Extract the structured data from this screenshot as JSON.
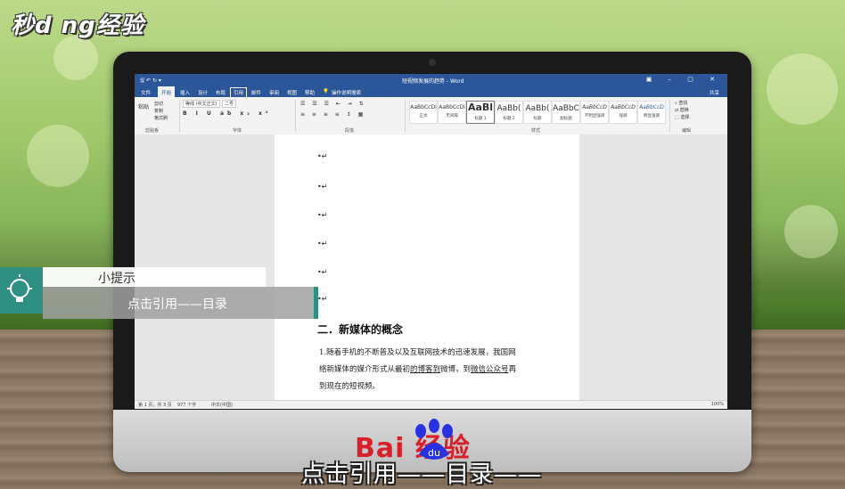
{
  "logo": "秒d ng经验",
  "brand": "Bai  经验",
  "brand_du": "du",
  "word": {
    "title": "短视频发展的趋势 - Word",
    "share": "共享",
    "tabs": [
      "文件",
      "开始",
      "插入",
      "设计",
      "布局",
      "引用",
      "邮件",
      "审阅",
      "视图",
      "帮助"
    ],
    "tell_me": "操作说明搜索",
    "ribbon": {
      "paste": "粘贴",
      "cut": "剪切",
      "copy": "复制",
      "format_painter": "格式刷",
      "font_name": "等线 (中文正文)",
      "font_size": "二号",
      "styles": [
        {
          "preview": "AaBbCcDi",
          "name": "正文"
        },
        {
          "preview": "AaBbCcDi",
          "name": "无间隔"
        },
        {
          "preview": "AaBl",
          "name": "标题 1"
        },
        {
          "preview": "AaBb(",
          "name": "标题 2"
        },
        {
          "preview": "AaBb(",
          "name": "标题"
        },
        {
          "preview": "AaBbC",
          "name": "副标题"
        },
        {
          "preview": "AaBbCcD",
          "name": "不明显强调"
        },
        {
          "preview": "AaBbCcD",
          "name": "强调"
        },
        {
          "preview": "AaBbCcD",
          "name": "明显强调"
        }
      ],
      "find": "查找",
      "replace": "替换",
      "select": "选择",
      "groups": {
        "clipboard": "剪贴板",
        "font": "字体",
        "paragraph": "段落",
        "styles": "样式",
        "editing": "编辑"
      }
    },
    "document": {
      "heading": "二．新媒体的概念",
      "para_line1": "1.随着手机的不断普及以及互联网技术的迅速发展，我国网",
      "para_line2_a": "络新媒体的媒介形式从最初",
      "para_line2_b": "的博客到",
      "para_line2_c": "微博，到",
      "para_line2_d": "微信公众号",
      "para_line2_e": "再",
      "para_line3": "到现在的短视频。"
    },
    "status": {
      "page": "第 1 页，共 3 页",
      "words": "977 个字",
      "lang": "中文(中国)",
      "zoom": "100%"
    }
  },
  "tip": {
    "title": "小提示",
    "text": "点击引用——目录"
  },
  "subtitle": "点击引用——目录——"
}
